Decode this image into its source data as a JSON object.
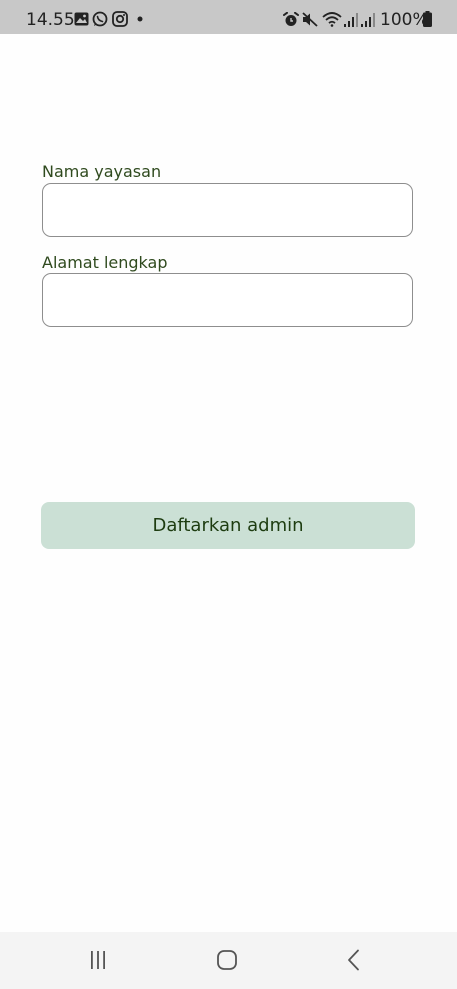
{
  "status_bar": {
    "time": "14.55",
    "battery": "100%",
    "notification_icons": [
      "gallery-icon",
      "whatsapp-icon",
      "instagram-icon",
      "dot-icon"
    ],
    "system_icons": [
      "alarm-icon",
      "mute-icon",
      "wifi-icon",
      "signal-icon",
      "signal-icon",
      "battery-icon"
    ]
  },
  "form": {
    "name_label": "Nama yayasan",
    "name_value": "",
    "address_label": "Alamat lengkap",
    "address_value": "",
    "submit_label": "Daftarkan admin"
  },
  "nav_bar": {
    "icons": [
      "recents-icon",
      "home-icon",
      "back-icon"
    ]
  },
  "colors": {
    "label_text": "#2f4a1e",
    "button_bg": "#cbe0d5",
    "button_text": "#1d3c10",
    "field_border": "#8e8e8e",
    "status_bar_bg": "#c8c8c8",
    "nav_bar_bg": "#f4f4f4"
  }
}
